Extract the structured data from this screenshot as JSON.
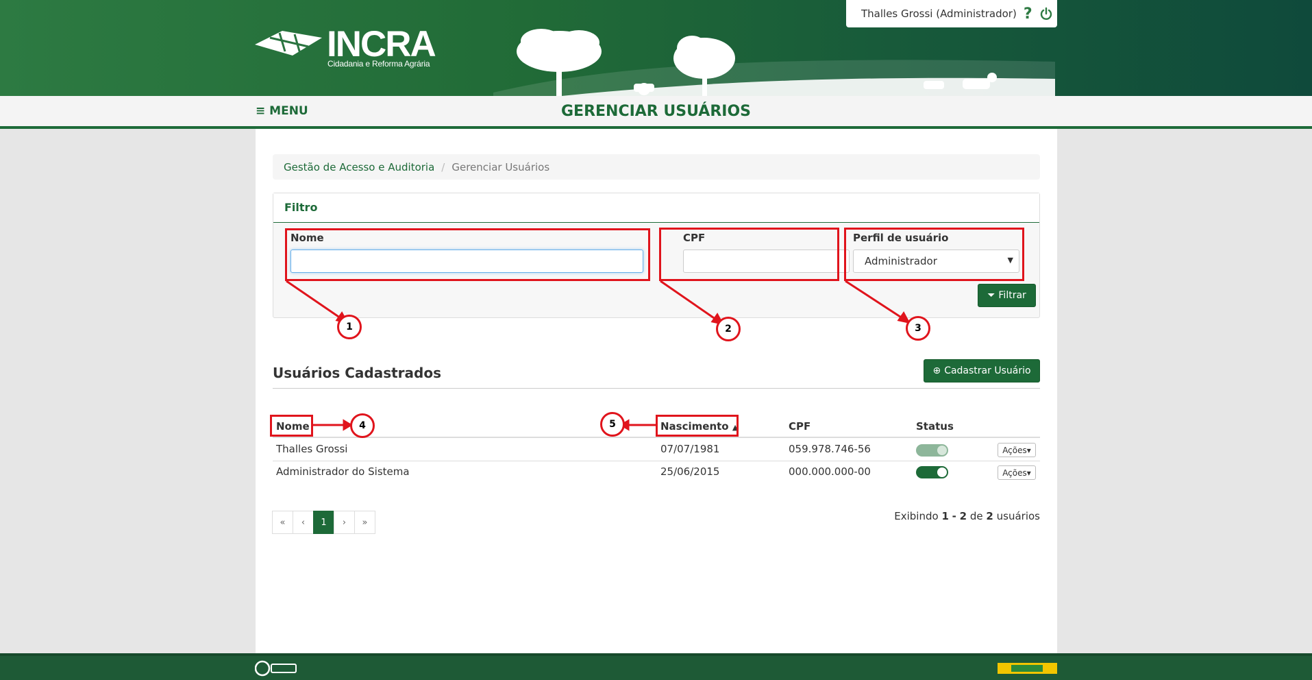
{
  "header": {
    "logo_text": "INCRA",
    "logo_sub": "Cidadania e Reforma Agrária",
    "user": "Thalles Grossi (Administrador)",
    "help_label": "?"
  },
  "titlebar": {
    "menu_label": "≡ MENU",
    "page_title": "GERENCIAR USUÁRIOS"
  },
  "breadcrumb": {
    "parent": "Gestão de Acesso e Auditoria",
    "separator": "/",
    "current": "Gerenciar Usuários"
  },
  "filter": {
    "title": "Filtro",
    "nome_label": "Nome",
    "nome_value": "",
    "cpf_label": "CPF",
    "cpf_value": "",
    "perfil_label": "Perfil de usuário",
    "perfil_value": "Administrador",
    "button": "Filtrar"
  },
  "list": {
    "title": "Usuários Cadastrados",
    "add_button": "Cadastrar Usuário",
    "columns": {
      "nome": "Nome",
      "nascimento": "Nascimento",
      "cpf": "CPF",
      "status": "Status"
    },
    "rows": [
      {
        "nome": "Thalles Grossi",
        "nascimento": "07/07/1981",
        "cpf": "059.978.746-56",
        "status": "ativo",
        "acoes": "Ações▾"
      },
      {
        "nome": "Administrador do Sistema",
        "nascimento": "25/06/2015",
        "cpf": "000.000.000-00",
        "status": "ativo",
        "acoes": "Ações▾"
      }
    ]
  },
  "pagination": {
    "first": "«",
    "prev": "‹",
    "current": "1",
    "next": "›",
    "last": "»",
    "info_prefix": "Exibindo",
    "from": "1",
    "dash": "-",
    "to": "2",
    "of": "de",
    "total": "2",
    "suffix": "usuários"
  },
  "annotations": {
    "labels": [
      "1",
      "2",
      "3",
      "4",
      "5"
    ],
    "color": "#e0141c"
  },
  "colors": {
    "brand_green": "#1d6a38",
    "banner_green": "#216b37"
  }
}
